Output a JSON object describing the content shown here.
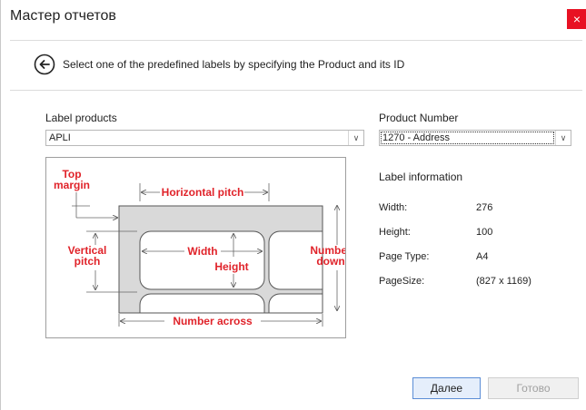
{
  "window": {
    "title": "Мастер отчетов",
    "close_glyph": "×"
  },
  "header": {
    "instruction": "Select one of the predefined labels by specifying the Product and its ID"
  },
  "label_products": {
    "label": "Label products",
    "value": "APLI"
  },
  "product_number": {
    "label": "Product Number",
    "value": "1270 - Address"
  },
  "diagram": {
    "top_margin": [
      "Top",
      "margin"
    ],
    "horizontal_pitch": "Horizontal pitch",
    "vertical_pitch": [
      "Vertical",
      "pitch"
    ],
    "width": "Width",
    "height": "Height",
    "number_down": [
      "Number",
      "down"
    ],
    "number_across": "Number across"
  },
  "label_info": {
    "title": "Label information",
    "rows": [
      {
        "key": "Width:",
        "value": "276"
      },
      {
        "key": "Height:",
        "value": "100"
      },
      {
        "key": "Page Type:",
        "value": "A4"
      },
      {
        "key": "PageSize:",
        "value": "(827 x 1169)"
      }
    ]
  },
  "buttons": {
    "next": "Далее",
    "finish": "Готово"
  },
  "colors": {
    "accent_red": "#e0232a",
    "diagram_gray": "#d9d9d9",
    "close_red": "#e81123"
  }
}
